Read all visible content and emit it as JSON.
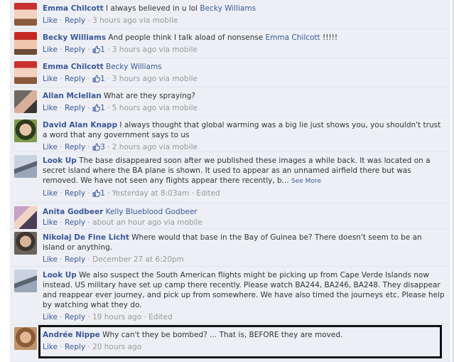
{
  "comments": [
    {
      "author": "Emma Chilcott",
      "text": " I always believed in u lol ",
      "mention": "Becky Williams",
      "like": "Like",
      "reply": "Reply",
      "likes": "",
      "time": "3 hours ago via mobile"
    },
    {
      "author": "Becky Williams",
      "text": " And people think I talk aload of nonsense ",
      "mention": "Emma Chilcott",
      "trailing": " !!!!!",
      "like": "Like",
      "reply": "Reply",
      "likes": "1",
      "time": "3 hours ago via mobile"
    },
    {
      "author": "Emma Chilcott",
      "text": " ",
      "mention": "Becky Williams",
      "like": "Like",
      "reply": "Reply",
      "likes": "1",
      "time": "3 hours ago via mobile"
    },
    {
      "author": "Allan Mclellan",
      "text": " What are they spraying?",
      "like": "Like",
      "reply": "Reply",
      "likes": "1",
      "time": "5 hours ago via mobile"
    },
    {
      "author": "David Alan Knapp",
      "text": " I always thought that global warming was a big lie just shows you, you shouldn't trust a word that any government says to us",
      "like": "Like",
      "reply": "Reply",
      "likes": "3",
      "time": "2 hours ago via mobile"
    },
    {
      "author": "Look Up",
      "text": " The base disappeared soon after we published these images a while back. It was located on a secret island where the BA plane is shown. It used to appear as an unnamed airfield there but was removed. We have not seen any flights appear there recently, b...",
      "see_more": "See More",
      "like": "Like",
      "reply": "Reply",
      "likes": "1",
      "time": "Yesterday at 8:03am",
      "edited": "Edited"
    },
    {
      "author": "Anita Godbeer",
      "text": " ",
      "mention": "Kelly Blueblood Godbeer",
      "like": "Like",
      "reply": "Reply",
      "likes": "",
      "time": "about an hour ago via mobile"
    },
    {
      "author": "Nikolaj De Fine Licht",
      "text": " Where would that base in the Bay of Guinea be? There doesn't seem to be an island or anything.",
      "like": "Like",
      "reply": "Reply",
      "likes": "",
      "time": "December 27 at 6:20pm"
    },
    {
      "author": "Look Up",
      "text": " We also suspect the South American flights might be picking up from Cape Verde Islands now instead. US military have set up camp there recently. Please watch BA244, BA246, BA248. They disappear and reappear ever journey, and pick up from somewhere. We have also timed the journeys etc. Please help by watching what they do.",
      "like": "Like",
      "reply": "Reply",
      "likes": "",
      "time": "19 hours ago",
      "edited": "Edited"
    },
    {
      "author": "Andrée Nippe",
      "text": " Why can't they be bombed? ... That is, BEFORE they are moved.",
      "like": "Like",
      "reply": "Reply",
      "likes": "",
      "time": "20 hours ago"
    }
  ],
  "separator": " · ",
  "icons": {
    "thumb": "thumbs-up-icon"
  },
  "colors": {
    "link": "#3b5998",
    "background": "#edeff4",
    "highlight_border": "#111111"
  }
}
